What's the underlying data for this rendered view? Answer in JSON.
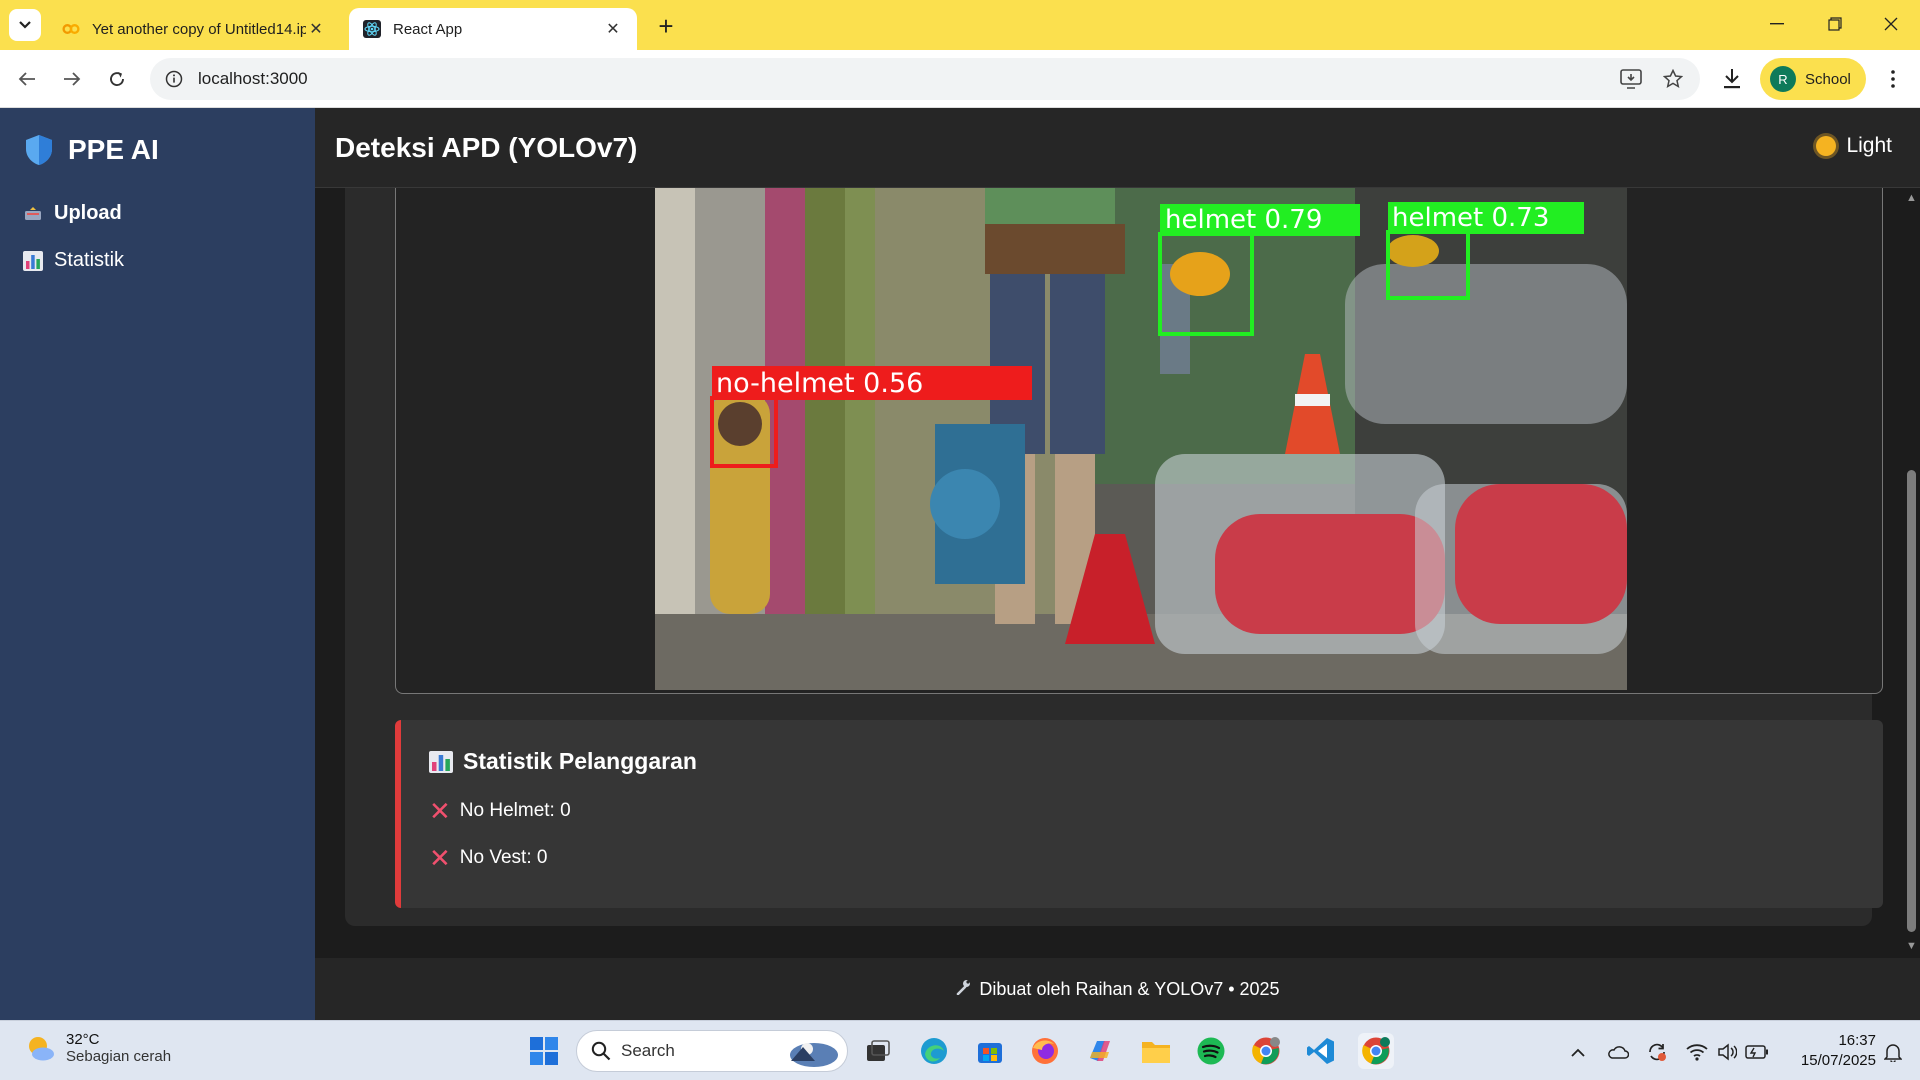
{
  "browser": {
    "tabs": [
      {
        "title": "Yet another copy of Untitled14.ipynb",
        "active": false
      },
      {
        "title": "React App",
        "active": true
      }
    ],
    "url": "localhost:3000",
    "profile_initial": "R",
    "profile_name": "School"
  },
  "app": {
    "brand": "PPE AI",
    "nav": [
      {
        "label": "Upload",
        "icon": "upload-tray-icon",
        "active": true
      },
      {
        "label": "Statistik",
        "icon": "bar-chart-icon",
        "active": false
      }
    ],
    "header_title": "Deteksi APD (YOLOv7)",
    "theme_toggle_label": "Light",
    "detections": [
      {
        "label": "helmet 0.79",
        "class": "helmet",
        "confidence": 0.79,
        "color": "#22ee22"
      },
      {
        "label": "helmet 0.73",
        "class": "helmet",
        "confidence": 0.73,
        "color": "#22ee22"
      },
      {
        "label": "no-helmet 0.56",
        "class": "no-helmet",
        "confidence": 0.56,
        "color": "#ee1c1c"
      }
    ],
    "stats": {
      "title": "Statistik Pelanggaran",
      "rows": [
        {
          "text": "No Helmet: 0"
        },
        {
          "text": "No Vest: 0"
        }
      ],
      "accent": "#e03b3b"
    },
    "footer": "Dibuat oleh Raihan & YOLOv7 • 2025"
  },
  "taskbar": {
    "weather_temp": "32°C",
    "weather_cond": "Sebagian cerah",
    "search_placeholder": "Search",
    "time": "16:37",
    "date": "15/07/2025"
  }
}
